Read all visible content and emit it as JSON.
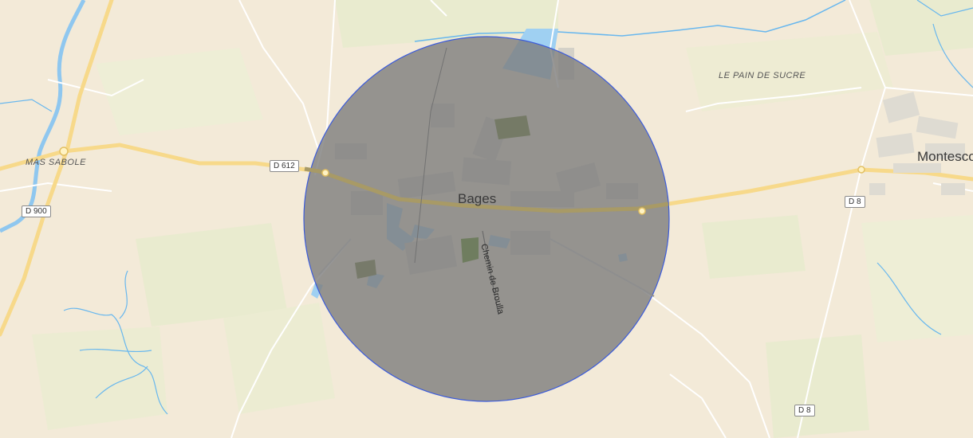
{
  "map": {
    "labels": {
      "town_bages": "Bages",
      "town_montescot": "Montesco",
      "locality_mas_sabole": "MAS SABOLE",
      "locality_pain_de_sucre": "LE PAIN DE SUCRE",
      "street_chemin_broulla": "Chemin de Broulla"
    },
    "road_shields": {
      "d612": "D 612",
      "d900": "D 900",
      "d8_north": "D 8",
      "d8_south": "D 8"
    },
    "overlay": {
      "shape": "circle",
      "fill_color": "#7d7d7d",
      "stroke_color": "#3b5bdb",
      "fill_opacity": 0.8
    },
    "colors": {
      "land": "#f3ead8",
      "fields": "#e9ebcf",
      "water": "#9fd0f2",
      "river": "#68b7ee",
      "main_road": "#f7d98a",
      "minor_road": "#ffffff"
    }
  }
}
